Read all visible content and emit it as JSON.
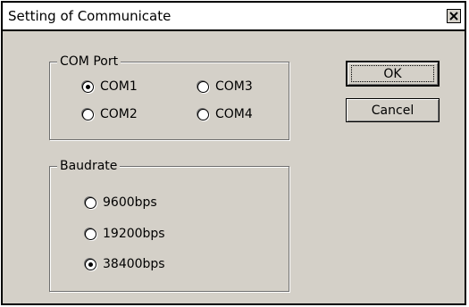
{
  "window": {
    "title": "Setting of Communicate",
    "close_glyph": "✕"
  },
  "com_port": {
    "legend": "COM Port",
    "options": [
      {
        "label": "COM1",
        "selected": true
      },
      {
        "label": "COM2",
        "selected": false
      },
      {
        "label": "COM3",
        "selected": false
      },
      {
        "label": "COM4",
        "selected": false
      }
    ]
  },
  "baudrate": {
    "legend": "Baudrate",
    "options": [
      {
        "label": "9600bps",
        "selected": false
      },
      {
        "label": "19200bps",
        "selected": false
      },
      {
        "label": "38400bps",
        "selected": true
      }
    ]
  },
  "buttons": {
    "ok_label": "OK",
    "cancel_label": "Cancel"
  },
  "colors": {
    "dialog_face": "#d4d0c8",
    "titlebar": "#ffffff"
  },
  "icons": {
    "close": "close-icon",
    "radio": "radio-button-icon"
  }
}
